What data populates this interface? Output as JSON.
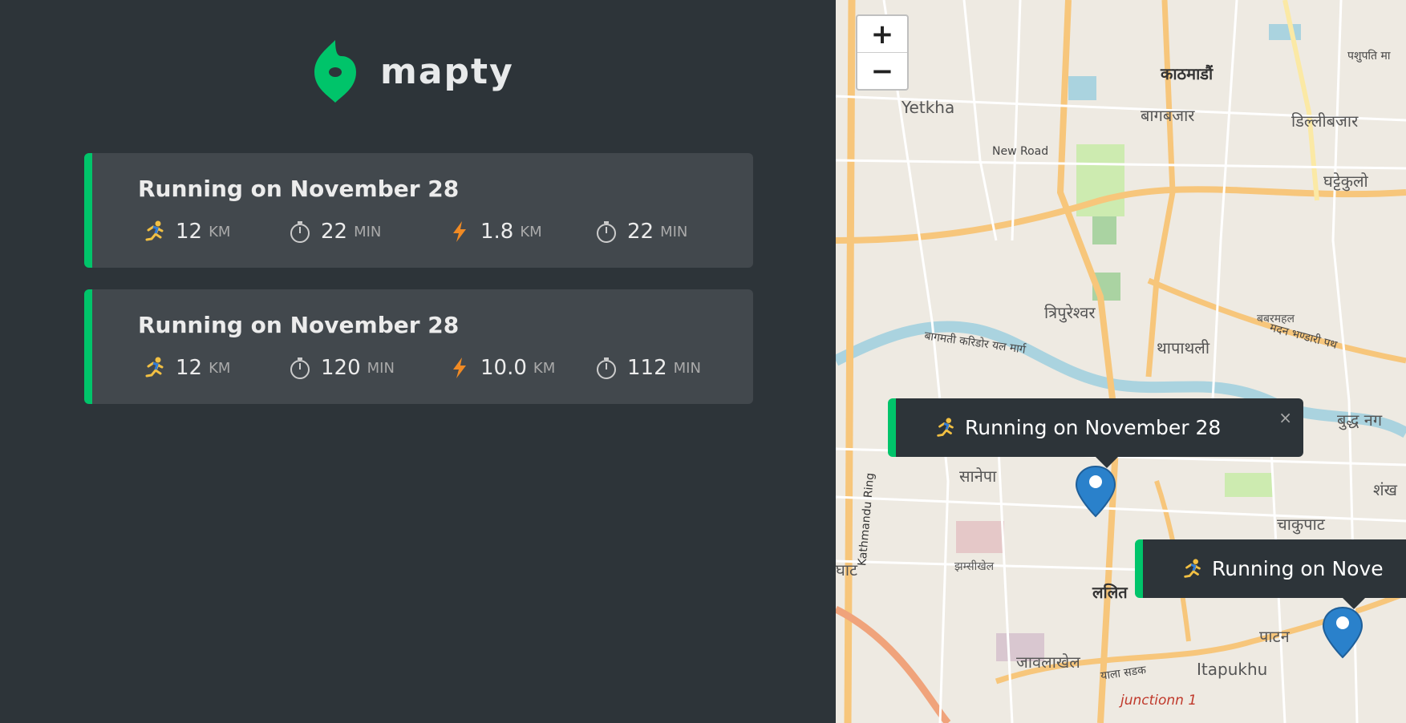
{
  "app": {
    "logo_text": "mapty",
    "accent": "#00c46a"
  },
  "workouts": [
    {
      "title": "Running on November 28",
      "distance": "12",
      "distance_unit": "km",
      "duration": "22",
      "duration_unit": "min",
      "pace": "1.8",
      "pace_unit": "km",
      "cadence": "22",
      "cadence_unit": "min"
    },
    {
      "title": "Running on November 28",
      "distance": "12",
      "distance_unit": "km",
      "duration": "120",
      "duration_unit": "min",
      "pace": "10.0",
      "pace_unit": "km",
      "cadence": "112",
      "cadence_unit": "min"
    }
  ],
  "map": {
    "zoom_in": "+",
    "zoom_out": "−",
    "popups": [
      {
        "text": "Running on November 28",
        "close": "×"
      },
      {
        "text": "Running on Nove"
      }
    ],
    "labels": {
      "kathmandu": "काठमाडौं",
      "yetkha": "Yetkha",
      "bagbazar": "बागबजार",
      "dillibazar": "डिल्लीबजार",
      "newroad": "New Road",
      "ghattekulo": "घट्टेकुलो",
      "tripureshwor": "त्रिपुरेश्वर",
      "babarmahal": "बबरमहल",
      "thapathali": "थापाथली",
      "bagmati": "बागमती करिडोर यल मार्ग",
      "sanepa": "सानेपा",
      "chakupat": "चाकुपाट",
      "jhamsikhel": "झम्सीखेल",
      "lalitpur": "ललित",
      "patan": "पाटन",
      "jawalakhel": "जावलाखेल",
      "itapukhu": "Itapukhu",
      "junction": "junctionn 1",
      "ghat": "घाट",
      "kathmandu_ring": "Kathmandu Ring",
      "buddhanagar": "बुद्ध नग",
      "shankha": "शंख",
      "madan": "मदन भण्डारी पथ",
      "yala": "याला सडक",
      "pashupati": "पशुपति मा"
    }
  }
}
